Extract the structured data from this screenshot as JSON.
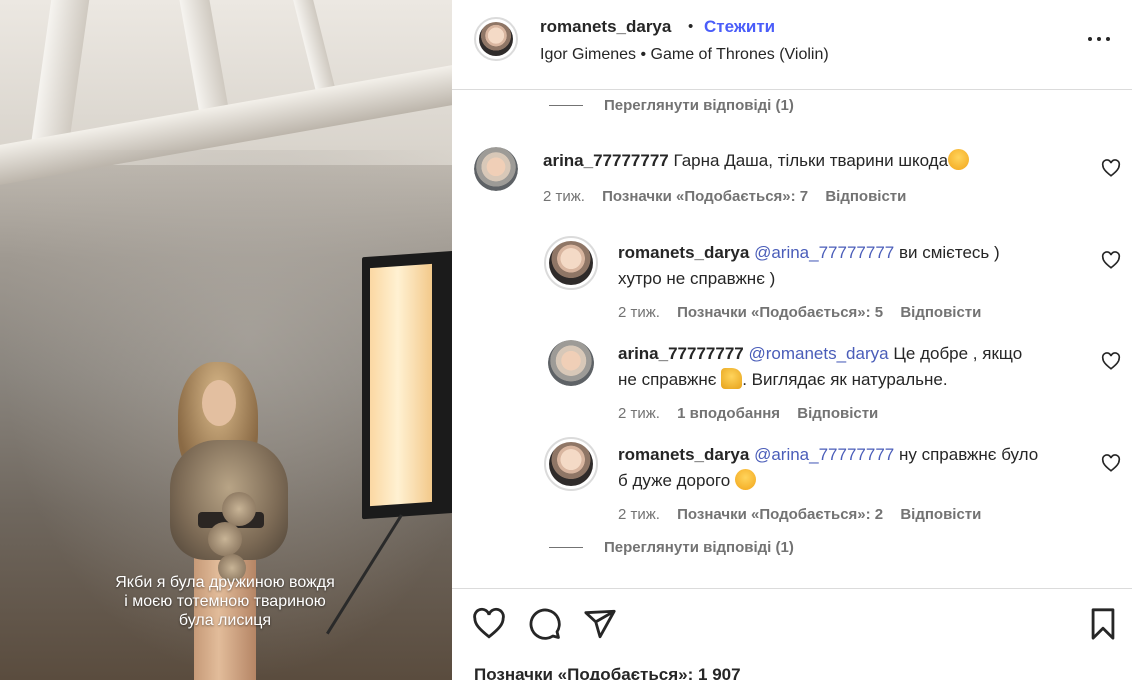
{
  "media": {
    "caption_lines": [
      "Якби я була дружиною вождя",
      "і моєю тотемною твариною",
      "була лисиця"
    ]
  },
  "header": {
    "username": "romanets_darya",
    "separator": "•",
    "follow_label": "Стежити",
    "music": "Igor Gimenes • Game of Thrones (Violin)"
  },
  "comments": {
    "view_replies_top": "Переглянути відповіді (1)",
    "main": {
      "username": "arina_77777777",
      "text": "Гарна Даша, тільки тварини шкода",
      "emoji": "😔",
      "time": "2 тиж.",
      "likes": "Позначки «Подобається»: 7",
      "reply": "Відповісти"
    },
    "replies": [
      {
        "username": "romanets_darya",
        "mention": "@arina_77777777",
        "text_line1": "ви смієтесь )",
        "text_line2": "хутро не справжнє )",
        "time": "2 тиж.",
        "likes": "Позначки «Подобається»: 5",
        "reply": "Відповісти"
      },
      {
        "username": "arina_77777777",
        "mention": "@romanets_darya",
        "text_line1": "Це добре , якщо",
        "text_line2": "не справжнє",
        "emoji": "👍",
        "text_after": ". Виглядає як натуральне.",
        "time": "2 тиж.",
        "likes": "1 вподобання",
        "reply": "Відповісти"
      },
      {
        "username": "romanets_darya",
        "mention": "@arina_77777777",
        "text_line1": "ну справжнє було",
        "text_line2": "б дуже дорого",
        "emoji": "😂",
        "time": "2 тиж.",
        "likes": "Позначки «Подобається»: 2",
        "reply": "Відповісти"
      }
    ],
    "view_replies_bottom": "Переглянути відповіді (1)"
  },
  "actions": {
    "likes": "Позначки «Подобається»: 1 907"
  },
  "colors": {
    "link_blue": "#4a5df9",
    "muted": "#737373",
    "text": "#262626",
    "border": "#dbdbdb"
  },
  "icons": [
    "more-options-icon",
    "heart-icon",
    "comment-icon",
    "share-icon",
    "bookmark-icon"
  ]
}
